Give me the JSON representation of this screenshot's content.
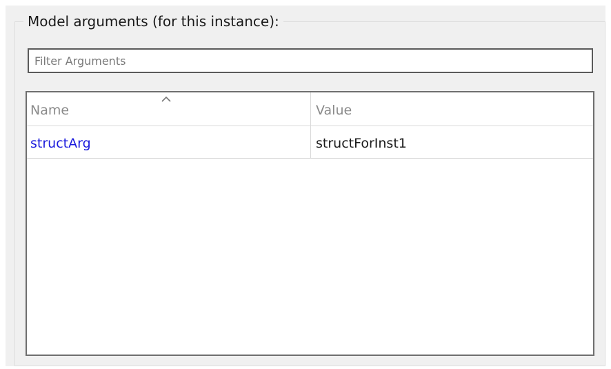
{
  "group": {
    "title": "Model arguments (for this instance):"
  },
  "filter": {
    "placeholder": "Filter Arguments",
    "value": ""
  },
  "table": {
    "columns": [
      {
        "label": "Name",
        "sorted": true
      },
      {
        "label": "Value"
      }
    ],
    "rows": [
      {
        "name": "structArg",
        "value": "structForInst1"
      }
    ]
  },
  "colors": {
    "panel_bg": "#f0f0f0",
    "link_text": "#1a1adc",
    "header_text": "#8a8a8a"
  },
  "icons": {
    "sort": "chevron-up-icon"
  }
}
